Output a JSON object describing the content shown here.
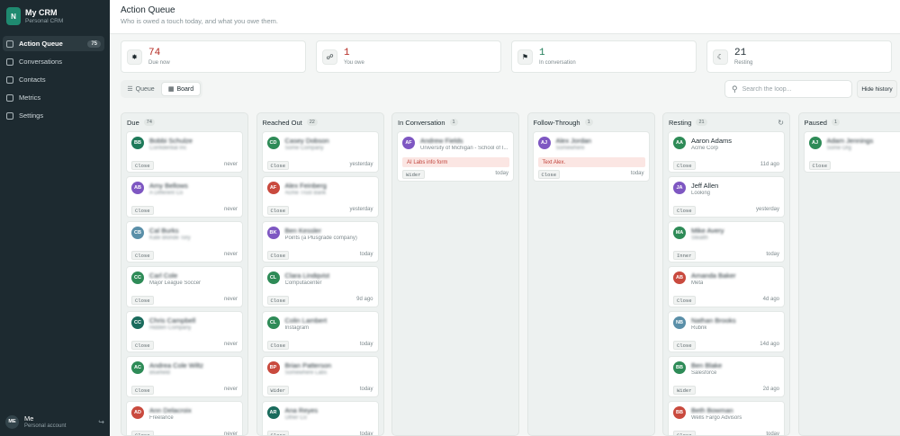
{
  "app": {
    "name": "My CRM",
    "subtitle": "Personal CRM",
    "logo_letter": "N"
  },
  "nav": [
    {
      "label": "Action Queue",
      "badge": "75",
      "active": true,
      "icon": "bolt-icon"
    },
    {
      "label": "Conversations",
      "badge": "",
      "active": false,
      "icon": "chat-icon"
    },
    {
      "label": "Contacts",
      "badge": "",
      "active": false,
      "icon": "users-icon"
    },
    {
      "label": "Metrics",
      "badge": "",
      "active": false,
      "icon": "chart-icon"
    },
    {
      "label": "Settings",
      "badge": "",
      "active": false,
      "icon": "gear-icon"
    }
  ],
  "account": {
    "initials": "ME",
    "name": "Me",
    "subtitle": "Personal account"
  },
  "header": {
    "title": "Action Queue",
    "subtitle": "Who is owed a touch today, and what you owe them."
  },
  "stats": [
    {
      "value": "74",
      "label": "Due now",
      "color": "#b3261e",
      "icon": "sparkle-icon"
    },
    {
      "value": "1",
      "label": "You owe",
      "color": "#b3261e",
      "icon": "link-icon"
    },
    {
      "value": "1",
      "label": "In conversation",
      "color": "#1b7a55",
      "icon": "flag-icon"
    },
    {
      "value": "21",
      "label": "Resting",
      "color": "#1d2a30",
      "icon": "moon-icon"
    }
  ],
  "view": {
    "queue_label": "Queue",
    "board_label": "Board",
    "active": "Board"
  },
  "search": {
    "placeholder": "Search the loop...",
    "value": ""
  },
  "hide_history_label": "Hide history",
  "columns": [
    {
      "title": "Due",
      "count": "74",
      "cards": [
        {
          "initials": "BB",
          "color": "#1f7a5a",
          "name": "Bobbi Schulze",
          "org": "Confidential Inc",
          "tag": "Close",
          "time": "never",
          "blur_name": true,
          "blur_org": true
        },
        {
          "initials": "AB",
          "color": "#7e57c2",
          "name": "Amy Bellows",
          "org": "A Different Co",
          "tag": "Close",
          "time": "never",
          "blur_name": true,
          "blur_org": true
        },
        {
          "initials": "CB",
          "color": "#5a8fa8",
          "name": "Cal Burks",
          "org": "Kate Blonde Tory",
          "tag": "Close",
          "time": "never",
          "blur_name": true,
          "blur_org": true
        },
        {
          "initials": "CC",
          "color": "#2e8b57",
          "name": "Carl Cole",
          "org": "Major League Soccer",
          "tag": "Close",
          "time": "never",
          "blur_name": true,
          "blur_org": false
        },
        {
          "initials": "CC",
          "color": "#1a6b5c",
          "name": "Chris Campbell",
          "org": "Hidden Company",
          "tag": "Close",
          "time": "never",
          "blur_name": true,
          "blur_org": true
        },
        {
          "initials": "AC",
          "color": "#2e8b57",
          "name": "Andrea Cole Wiltz",
          "org": "Bluefield",
          "tag": "Close",
          "time": "never",
          "blur_name": true,
          "blur_org": true
        },
        {
          "initials": "AD",
          "color": "#c94a3e",
          "name": "Ann Delacroix",
          "org": "Freelance",
          "tag": "Close",
          "time": "never",
          "blur_name": true,
          "blur_org": false
        }
      ]
    },
    {
      "title": "Reached Out",
      "count": "22",
      "cards": [
        {
          "initials": "CD",
          "color": "#2e8b57",
          "name": "Casey Dobson",
          "org": "Some Company",
          "tag": "Close",
          "time": "yesterday",
          "blur_name": true,
          "blur_org": true
        },
        {
          "initials": "AF",
          "color": "#c94a3e",
          "name": "Alex Feinberg",
          "org": "Acme Trust Bank",
          "tag": "Close",
          "time": "yesterday",
          "blur_name": true,
          "blur_org": true
        },
        {
          "initials": "BK",
          "color": "#7e57c2",
          "name": "Ben Kessler",
          "org": "Points (a Plusgrade company)",
          "tag": "Close",
          "time": "today",
          "blur_name": true,
          "blur_org": false
        },
        {
          "initials": "CL",
          "color": "#2e8b57",
          "name": "Clara Lindqvist",
          "org": "Computacenter",
          "tag": "Close",
          "time": "9d ago",
          "blur_name": true,
          "blur_org": false
        },
        {
          "initials": "CL",
          "color": "#2e8b57",
          "name": "Colin Lambert",
          "org": "Instagram",
          "tag": "Close",
          "time": "today",
          "blur_name": true,
          "blur_org": false
        },
        {
          "initials": "BP",
          "color": "#c94a3e",
          "name": "Brian Patterson",
          "org": "Somewhere Labs",
          "tag": "Wider",
          "time": "today",
          "blur_name": true,
          "blur_org": true
        },
        {
          "initials": "AR",
          "color": "#1a6b5c",
          "name": "Ana Reyes",
          "org": "Other Co",
          "tag": "Close",
          "time": "today",
          "blur_name": true,
          "blur_org": true
        }
      ]
    },
    {
      "title": "In Conversation",
      "count": "1",
      "cards": [
        {
          "initials": "AF",
          "color": "#7e57c2",
          "name": "Andrew Fields",
          "org": "University of Michigan - School of I...",
          "note": "AI Labs info form",
          "tag": "Wider",
          "time": "today",
          "blur_name": true,
          "blur_org": false
        }
      ]
    },
    {
      "title": "Follow-Through",
      "count": "1",
      "cards": [
        {
          "initials": "AJ",
          "color": "#7e57c2",
          "name": "Alex Jordan",
          "org": "Somewhere",
          "note": "Text Alex.",
          "tag": "Close",
          "time": "today",
          "blur_name": true,
          "blur_org": true
        }
      ]
    },
    {
      "title": "Resting",
      "count": "21",
      "refresh": true,
      "cards": [
        {
          "initials": "AA",
          "color": "#2e8b57",
          "name": "Aaron Adams",
          "org": "Acme Corp",
          "tag": "Close",
          "time": "11d ago",
          "blur_name": false,
          "blur_org": false
        },
        {
          "initials": "JA",
          "color": "#7e57c2",
          "name": "Jeff Allen",
          "org": "Looking",
          "tag": "Close",
          "time": "yesterday",
          "blur_name": false,
          "blur_org": false
        },
        {
          "initials": "MA",
          "color": "#2e8b57",
          "name": "Mike Avery",
          "org": "Stealth",
          "tag": "Inner",
          "time": "today",
          "blur_name": true,
          "blur_org": true
        },
        {
          "initials": "AB",
          "color": "#c94a3e",
          "name": "Amanda Baker",
          "org": "Meta",
          "tag": "Close",
          "time": "4d ago",
          "blur_name": true,
          "blur_org": false
        },
        {
          "initials": "NB",
          "color": "#5a8fa8",
          "name": "Nathan Brooks",
          "org": "Rubrik",
          "tag": "Close",
          "time": "14d ago",
          "blur_name": true,
          "blur_org": false
        },
        {
          "initials": "BB",
          "color": "#2e8b57",
          "name": "Ben Blake",
          "org": "Salesforce",
          "tag": "Wider",
          "time": "2d ago",
          "blur_name": true,
          "blur_org": false
        },
        {
          "initials": "BB",
          "color": "#c94a3e",
          "name": "Beth Bowman",
          "org": "Wells Fargo Advisors",
          "tag": "Close",
          "time": "today",
          "blur_name": true,
          "blur_org": false
        }
      ]
    },
    {
      "title": "Paused",
      "count": "1",
      "cards": [
        {
          "initials": "AJ",
          "color": "#2e8b57",
          "name": "Adam Jennings",
          "org": "Some Org",
          "tag": "Close",
          "time": "",
          "blur_name": true,
          "blur_org": true
        }
      ]
    }
  ]
}
